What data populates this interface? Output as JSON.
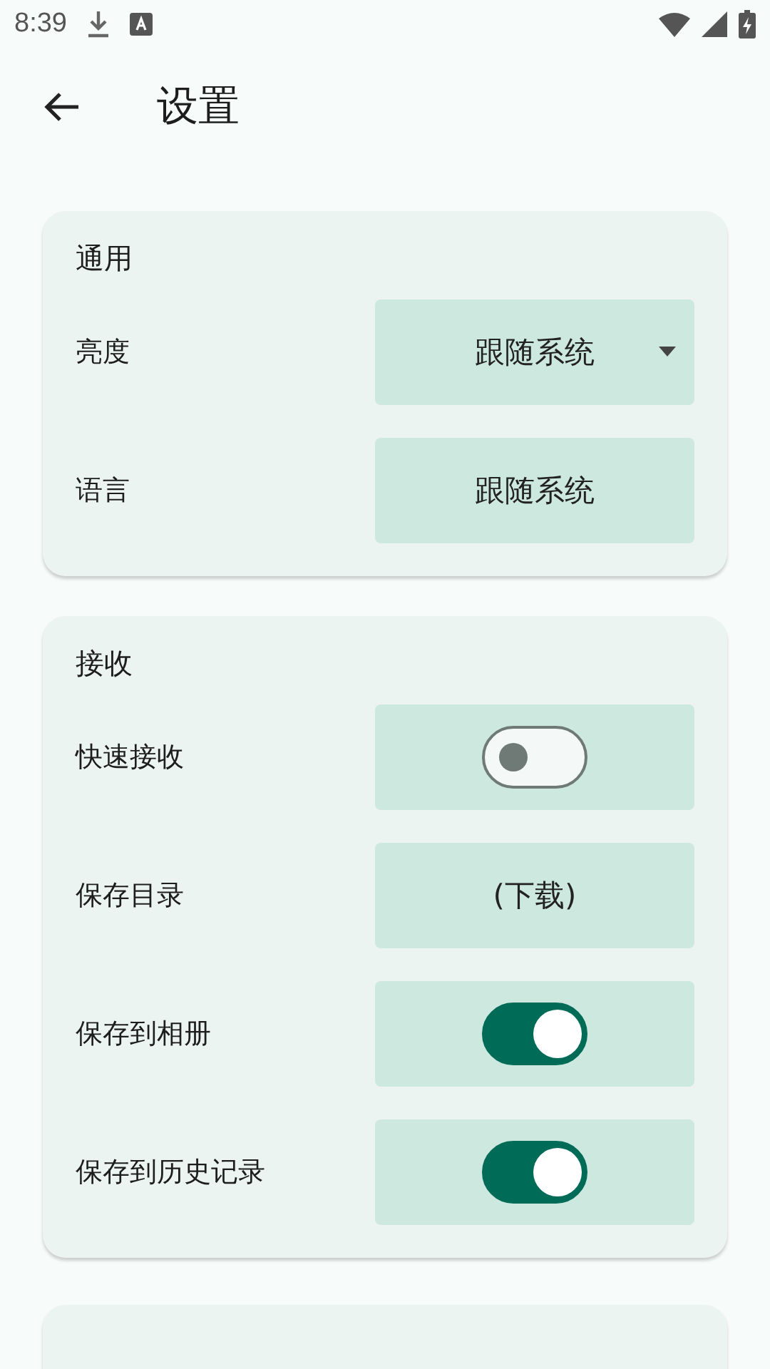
{
  "status_bar": {
    "time": "8:39"
  },
  "header": {
    "title": "设置"
  },
  "sections": [
    {
      "title": "通用",
      "rows": [
        {
          "label": "亮度",
          "kind": "dropdown",
          "value": "跟随系统"
        },
        {
          "label": "语言",
          "kind": "button",
          "value": "跟随系统"
        }
      ]
    },
    {
      "title": "接收",
      "rows": [
        {
          "label": "快速接收",
          "kind": "switch",
          "on": false
        },
        {
          "label": "保存目录",
          "kind": "button",
          "value": "(下载)"
        },
        {
          "label": "保存到相册",
          "kind": "switch",
          "on": true
        },
        {
          "label": "保存到历史记录",
          "kind": "switch",
          "on": true
        }
      ]
    }
  ]
}
